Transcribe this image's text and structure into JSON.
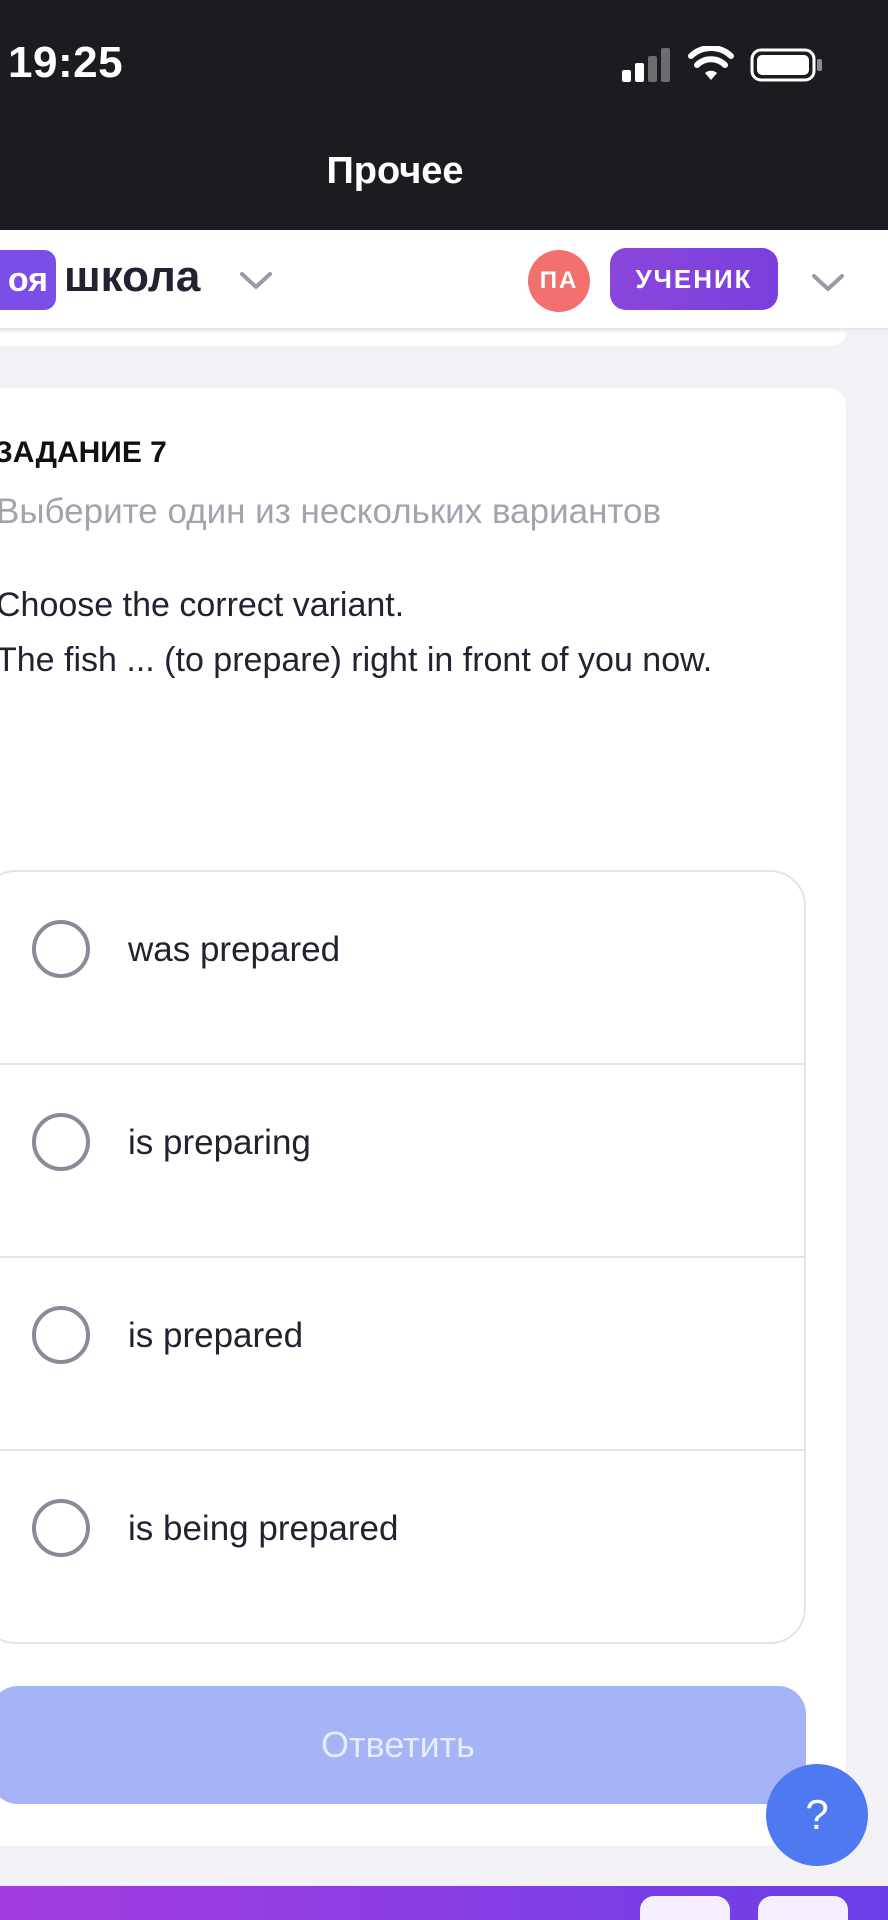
{
  "status_bar": {
    "time": "19:25"
  },
  "nav": {
    "title": "Прочее"
  },
  "header": {
    "logo_text": "оя",
    "school_name": "школа",
    "avatar_initials": "ПА",
    "role_badge": "УЧЕНИК"
  },
  "task": {
    "title": "ЗАДАНИЕ 7",
    "hint": "Выберите один из нескольких вариантов",
    "question_line1": "Choose the correct variant.",
    "question_line2": "The fish ... (to prepare) right in front of you now.",
    "options": [
      {
        "label": "was prepared",
        "selected": false
      },
      {
        "label": "is preparing",
        "selected": false
      },
      {
        "label": "is prepared",
        "selected": false
      },
      {
        "label": "is being prepared",
        "selected": false
      }
    ],
    "submit_label": "Ответить"
  },
  "help": {
    "label": "?"
  },
  "colors": {
    "accent": "#7b4ee8",
    "submit_disabled": "#a4b4f6",
    "help": "#4e79f0",
    "avatar": "#f2716f"
  }
}
